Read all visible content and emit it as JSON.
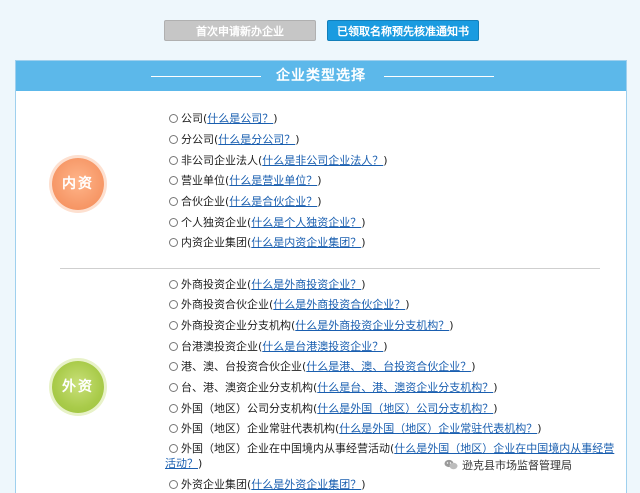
{
  "top_buttons": {
    "first_apply": "首次申请新办企业",
    "obtained_name": "已领取名称预先核准通知书"
  },
  "panel": {
    "title": "企业类型选择"
  },
  "groups": {
    "domestic_label": "内资",
    "foreign_label": "外资"
  },
  "domestic_options": [
    {
      "label": "公司(",
      "link": "什么是公司？",
      "tail": ")"
    },
    {
      "label": "分公司(",
      "link": "什么是分公司？",
      "tail": ")"
    },
    {
      "label": "非公司企业法人(",
      "link": "什么是非公司企业法人？",
      "tail": ")"
    },
    {
      "label": "营业单位(",
      "link": "什么是营业单位？",
      "tail": ")"
    },
    {
      "label": "合伙企业(",
      "link": "什么是合伙企业？",
      "tail": ")"
    },
    {
      "label": "个人独资企业(",
      "link": "什么是个人独资企业？",
      "tail": ")"
    },
    {
      "label": "内资企业集团(",
      "link": "什么是内资企业集团？",
      "tail": ")"
    }
  ],
  "foreign_options": [
    {
      "label": "外商投资企业(",
      "link": "什么是外商投资企业？",
      "tail": ")"
    },
    {
      "label": "外商投资合伙企业(",
      "link": "什么是外商投资合伙企业？",
      "tail": ")"
    },
    {
      "label": "外商投资企业分支机构(",
      "link": "什么是外商投资企业分支机构？",
      "tail": ")"
    },
    {
      "label": "台港澳投资企业(",
      "link": "什么是台港澳投资企业？",
      "tail": ")"
    },
    {
      "label": "港、澳、台投资合伙企业(",
      "link": "什么是港、澳、台投资合伙企业？",
      "tail": ")"
    },
    {
      "label": "台、港、澳资企业分支机构(",
      "link": "什么是台、港、澳资企业分支机构？",
      "tail": ")"
    },
    {
      "label": "外国（地区）公司分支机构(",
      "link": "什么是外国（地区）公司分支机构？",
      "tail": ")"
    },
    {
      "label": "外国（地区）企业常驻代表机构(",
      "link": "什么是外国（地区）企业常驻代表机构？",
      "tail": ")"
    },
    {
      "label": "外国（地区）企业在中国境内从事经营活动(",
      "link": "什么是外国（地区）企业在中国境内从事经营",
      "link2": "活动？",
      "tail": ")"
    },
    {
      "label": "外资企业集团(",
      "link": "什么是外资企业集团？",
      "tail": ")"
    }
  ],
  "watermark": {
    "text": "逊克县市场监督管理局",
    "icon": "wechat-icon"
  },
  "colors": {
    "header_blue": "#5cb8ea",
    "button_blue": "#1a9be0",
    "button_gray": "#c6c6c6",
    "domestic_orange": "#f79a6a",
    "foreign_green": "#a9cb4a",
    "link_blue": "#1a5fb0"
  }
}
